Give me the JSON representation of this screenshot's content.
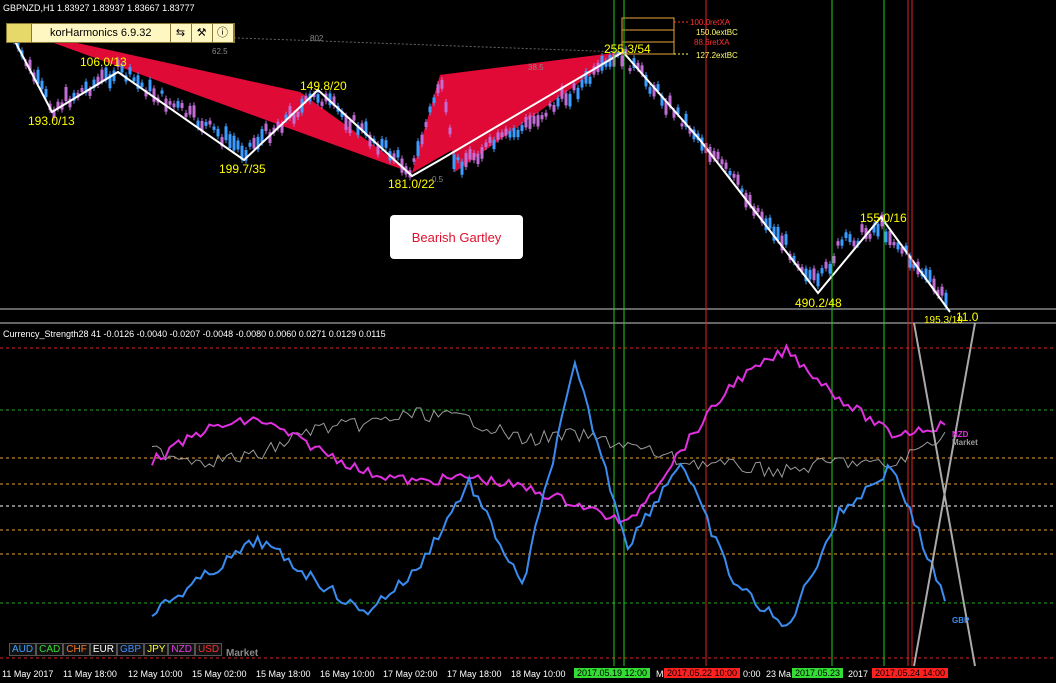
{
  "chart": {
    "symbol_info": "GBPNZD,H1  1.83927 1.83937 1.83667 1.83777",
    "indicator_header": "Currency_Strength28 41 -0.0126 -0.0040 -0.0207 -0.0048 -0.0080 0.0060 0.0271 0.0129 0.0115",
    "pattern_label": "Bearish Gartley",
    "toolbar": {
      "title": "korHarmonics 6.9.32",
      "buttons": [
        {
          "name": "scroll-button",
          "glyph": "⇆"
        },
        {
          "name": "tools-button",
          "glyph": "⚒"
        },
        {
          "name": "info-button",
          "glyph": "ⓘ"
        }
      ]
    },
    "point_labels": [
      {
        "id": "p1",
        "text": "193.0/13"
      },
      {
        "id": "p2",
        "text": "106.0/13"
      },
      {
        "id": "p3",
        "text": "199.7/35"
      },
      {
        "id": "p4",
        "text": "149.8/20"
      },
      {
        "id": "p5",
        "text": "181.0/22"
      },
      {
        "id": "p6",
        "text": "255.3/54"
      },
      {
        "id": "p7",
        "text": "490.2/48"
      },
      {
        "id": "p8",
        "text": "155.0/16"
      },
      {
        "id": "p9",
        "text": "195.3/19"
      },
      {
        "id": "p10",
        "text": "11.0"
      }
    ],
    "fib_labels": [
      {
        "id": "f1",
        "text": "100.0retXA",
        "color": "#ff3030"
      },
      {
        "id": "f2",
        "text": "150.0extBC",
        "color": "#ffff66"
      },
      {
        "id": "f3",
        "text": "88.6retXA",
        "color": "#ff3030"
      },
      {
        "id": "f4",
        "text": "127.2extBC",
        "color": "#ffff66"
      },
      {
        "id": "f5",
        "text": "802",
        "color": "#888888"
      },
      {
        "id": "f6",
        "text": "62.5",
        "color": "#888888"
      },
      {
        "id": "f7",
        "text": "38.5",
        "color": "#888888"
      },
      {
        "id": "f8",
        "text": "0.5",
        "color": "#888888"
      }
    ],
    "currency_buttons": [
      {
        "code": "AUD",
        "color": "#3da0ff"
      },
      {
        "code": "CAD",
        "color": "#33dd33"
      },
      {
        "code": "CHF",
        "color": "#ff7a2a"
      },
      {
        "code": "EUR",
        "color": "#ffffff"
      },
      {
        "code": "GBP",
        "color": "#3d8fff"
      },
      {
        "code": "JPY",
        "color": "#ffff33"
      },
      {
        "code": "NZD",
        "color": "#e040e0"
      },
      {
        "code": "USD",
        "color": "#ff3030"
      }
    ],
    "market_label": "Market",
    "line_end_labels": {
      "nzd": "NZD",
      "market": "Market",
      "gbp": "GBP"
    },
    "time_labels": [
      "11 May 2017",
      "11 May 18:00",
      "12 May 10:00",
      "15 May 02:00",
      "15 May 18:00",
      "16 May 10:00",
      "17 May 02:00",
      "17 May 18:00",
      "18 May 10:00"
    ],
    "time_highlights": [
      {
        "text": "2017.05.19 12:00",
        "bg": "#33dd33"
      },
      {
        "text": "2017.05.22 10:00",
        "bg": "#ff2020"
      },
      {
        "text": "2017.05.23",
        "bg": "#33dd33"
      },
      {
        "text": "2017.05.24 14:00",
        "bg": "#ff2020"
      }
    ],
    "time_fragments": [
      "Ma",
      "0:00",
      "23 Ma",
      "2017",
      "2017"
    ],
    "colors": {
      "bull_candle": "#3d9cff",
      "bear_candle": "#c26cd6",
      "pattern_fill": "#e00a36",
      "zigzag": "#ffffff",
      "gbp_line": "#3a8cf0",
      "nzd_line": "#e030e0",
      "market_line": "#9a9a9a",
      "vline_green": "#22cc22",
      "vline_red": "#dd2222"
    }
  },
  "chart_data": [
    {
      "type": "line",
      "title": "GBPNZD,H1",
      "series": [
        {
          "name": "GBPNZD",
          "values": [
            1.847,
            1.844,
            1.8475,
            1.8415,
            1.848,
            1.844,
            1.8495,
            1.843,
            1.845,
            1.852,
            1.836,
            1.828,
            1.832,
            1.826,
            1.829,
            1.819
          ]
        }
      ]
    },
    {
      "type": "line",
      "title": "Currency_Strength28",
      "series": [
        {
          "name": "NZD",
          "values": [
            0.006,
            0.012,
            0.014,
            0.009,
            0.004,
            0.002,
            0.003,
            0.001,
            -0.002,
            -0.006,
            0.008,
            0.021,
            0.0271,
            0.018,
            0.011,
            0.0129
          ]
        },
        {
          "name": "GBP",
          "values": [
            -0.023,
            -0.016,
            -0.009,
            -0.016,
            -0.023,
            -0.015,
            0.002,
            -0.018,
            0.024,
            -0.01,
            0.006,
            -0.017,
            -0.026,
            -0.004,
            0.005,
            -0.0207
          ]
        },
        {
          "name": "Market",
          "values": [
            0.008,
            0.006,
            0.007,
            0.012,
            0.013,
            0.015,
            0.014,
            0.01,
            0.011,
            0.009,
            0.006,
            0.005,
            0.004,
            0.006,
            0.005,
            0.0115
          ]
        }
      ]
    }
  ]
}
